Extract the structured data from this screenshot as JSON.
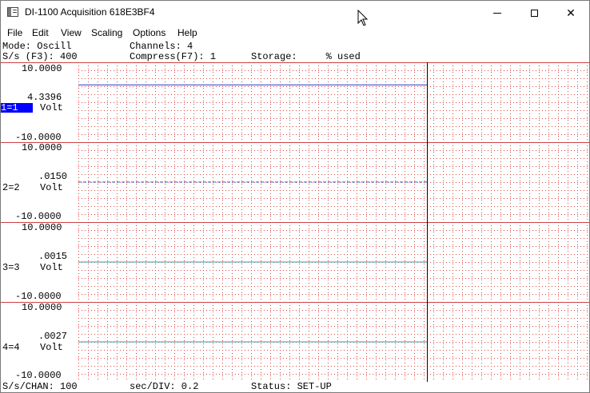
{
  "window": {
    "title": "DI-1100 Acquisition 618E3BF4",
    "icon": "app-window-icon",
    "controls": {
      "minimize": "minimize-icon",
      "maximize": "maximize-icon",
      "close": "close-icon",
      "close_glyph": "✕"
    }
  },
  "menu": {
    "file": "File",
    "edit": "Edit",
    "view": "View",
    "scaling": "Scaling",
    "options": "Options",
    "help": "Help"
  },
  "header": {
    "mode": "Mode: Oscill",
    "channels": "Channels: 4",
    "sample_rate": "S/s (F3): 400",
    "compress": "Compress(F7): 1",
    "storage": "Storage:     % used"
  },
  "channels": [
    {
      "top": "10.0000",
      "value": "4.3396",
      "name": "1=1",
      "unit": "Volt",
      "bottom": "-10.0000",
      "color": "#1f3fd6",
      "level": 4.3396,
      "selected": true
    },
    {
      "top": "10.0000",
      "value": ".0150",
      "name": "2=2",
      "unit": "Volt",
      "bottom": "-10.0000",
      "color": "#3a5ec8",
      "level": 0.015,
      "selected": false
    },
    {
      "top": "10.0000",
      "value": ".0015",
      "name": "3=3",
      "unit": "Volt",
      "bottom": "-10.0000",
      "color": "#3aa0a8",
      "level": 0.0015,
      "selected": false
    },
    {
      "top": "10.0000",
      "value": ".0027",
      "name": "4=4",
      "unit": "Volt",
      "bottom": "-10.0000",
      "color": "#3aa0a8",
      "level": 0.0027,
      "selected": false
    }
  ],
  "status": {
    "sps_chan": "S/s/CHAN: 100",
    "sec_div": "sec/DIV: 0.2",
    "state": "Status: SET-UP"
  },
  "colors": {
    "grid_dot": "#e04040",
    "divider": "#d04040",
    "cursor_line": "#000000",
    "selected_bg": "#0000ff"
  }
}
